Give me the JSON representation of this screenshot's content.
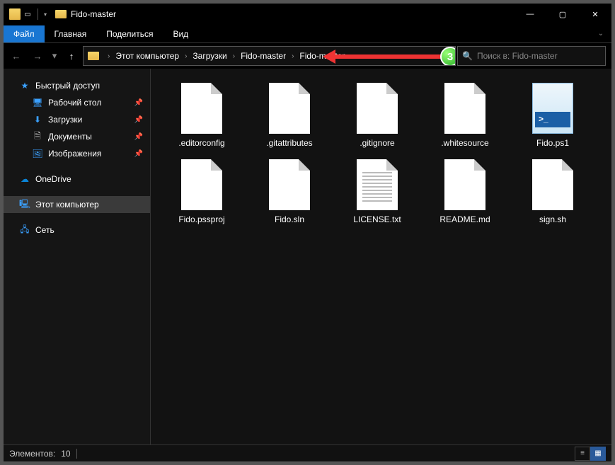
{
  "window": {
    "title": "Fido-master"
  },
  "menu": {
    "file": "Файл",
    "home": "Главная",
    "share": "Поделиться",
    "view": "Вид"
  },
  "breadcrumb": {
    "items": [
      "Этот компьютер",
      "Загрузки",
      "Fido-master",
      "Fido-master"
    ]
  },
  "annotation": {
    "step": "3"
  },
  "search": {
    "placeholder": "Поиск в: Fido-master"
  },
  "sidebar": {
    "quick_access": "Быстрый доступ",
    "desktop": "Рабочий стол",
    "downloads": "Загрузки",
    "documents": "Документы",
    "pictures": "Изображения",
    "onedrive": "OneDrive",
    "this_pc": "Этот компьютер",
    "network": "Сеть"
  },
  "files": [
    {
      "name": ".editorconfig",
      "type": "blank"
    },
    {
      "name": ".gitattributes",
      "type": "blank"
    },
    {
      "name": ".gitignore",
      "type": "blank"
    },
    {
      "name": ".whitesource",
      "type": "blank"
    },
    {
      "name": "Fido.ps1",
      "type": "ps1"
    },
    {
      "name": "Fido.pssproj",
      "type": "blank"
    },
    {
      "name": "Fido.sln",
      "type": "blank"
    },
    {
      "name": "LICENSE.txt",
      "type": "txt"
    },
    {
      "name": "README.md",
      "type": "blank"
    },
    {
      "name": "sign.sh",
      "type": "blank"
    }
  ],
  "status": {
    "label": "Элементов:",
    "count": "10"
  }
}
